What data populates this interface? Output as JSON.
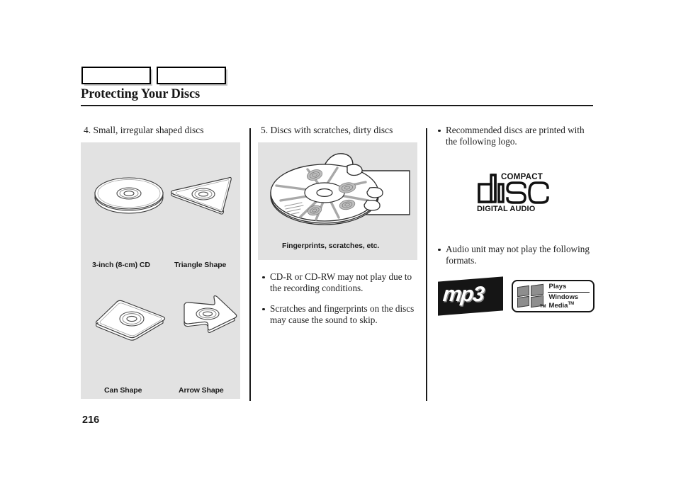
{
  "header": {
    "tabs": [
      {
        "name": "tab-box-1",
        "label": ""
      },
      {
        "name": "tab-box-2",
        "label": ""
      }
    ],
    "title": "Protecting Your Discs"
  },
  "columns": {
    "left": {
      "heading": "4. Small, irregular shaped discs",
      "figures": [
        {
          "icon": "compact-disc-isometric",
          "caption": "3-inch (8-cm) CD"
        },
        {
          "icon": "triangle-disc-isometric",
          "caption": "Triangle Shape"
        },
        {
          "icon": "can-shape-disc-isometric",
          "caption": "Can Shape"
        },
        {
          "icon": "arrow-shape-disc-isometric",
          "caption": "Arrow Shape"
        }
      ]
    },
    "middle": {
      "heading": "5. Discs with scratches, dirty discs",
      "figure_caption": "Fingerprints, scratches, etc.",
      "figure_icon": "hand-holding-dirty-disc",
      "bullets": [
        "CD-R or CD-RW may not play due to the recording conditions.",
        "Scratches and fingerprints on the discs may cause the sound to skip."
      ]
    },
    "right": {
      "bullet_1": "Recommended discs are printed with the following logo.",
      "cd_logo": {
        "top": "COMPACT",
        "middle": "disc",
        "bottom": "DIGITAL AUDIO"
      },
      "bullet_2": "Audio unit may not play the following formats.",
      "format_logos": {
        "mp3": "mp3",
        "windows_media": {
          "plays": "Plays",
          "line1": "Windows",
          "line2": "Media",
          "tm": "TM",
          "flag_tm": "TM"
        }
      }
    }
  },
  "footer": {
    "page_number": "216"
  },
  "colors": {
    "panel_gray": "#e2e2e2",
    "ink": "#1a1a1a",
    "logo_gray": "#8e8e8e"
  }
}
